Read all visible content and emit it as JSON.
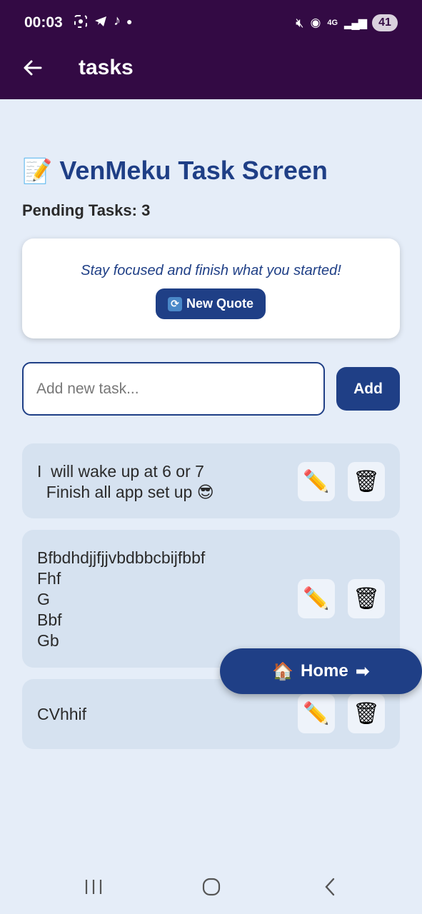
{
  "status_bar": {
    "time": "00:03",
    "battery": "41",
    "network": "4G"
  },
  "app_bar": {
    "title": "tasks"
  },
  "page": {
    "heading": "VenMeku Task Screen",
    "heading_emoji": "📝",
    "pending_label": "Pending Tasks: 3"
  },
  "quote": {
    "text": "Stay focused and finish what you started!",
    "button_label": "New Quote",
    "button_icon": "🔄"
  },
  "input": {
    "placeholder": "Add new task...",
    "value": ""
  },
  "add_button": {
    "label": "Add"
  },
  "tasks": [
    {
      "text": "I  will wake up at 6 or 7\n  Finish all app set up 😎",
      "edit_icon": "✏️",
      "delete_icon": "🗑"
    },
    {
      "text": "Bfbdhdjjfjjvbdbbcbijfbbf\nFhf\nG\nBbf\nGb",
      "edit_icon": "✏️",
      "delete_icon": "🗑"
    },
    {
      "text": "CVhhif",
      "edit_icon": "✏️",
      "delete_icon": "🗑"
    }
  ],
  "home_button": {
    "label": "Home",
    "icon_left": "🏠",
    "icon_right": "➡"
  },
  "colors": {
    "app_bar": "#330a44",
    "accent": "#1f3f86",
    "background": "#e5edf8",
    "card": "#d6e2f0"
  }
}
